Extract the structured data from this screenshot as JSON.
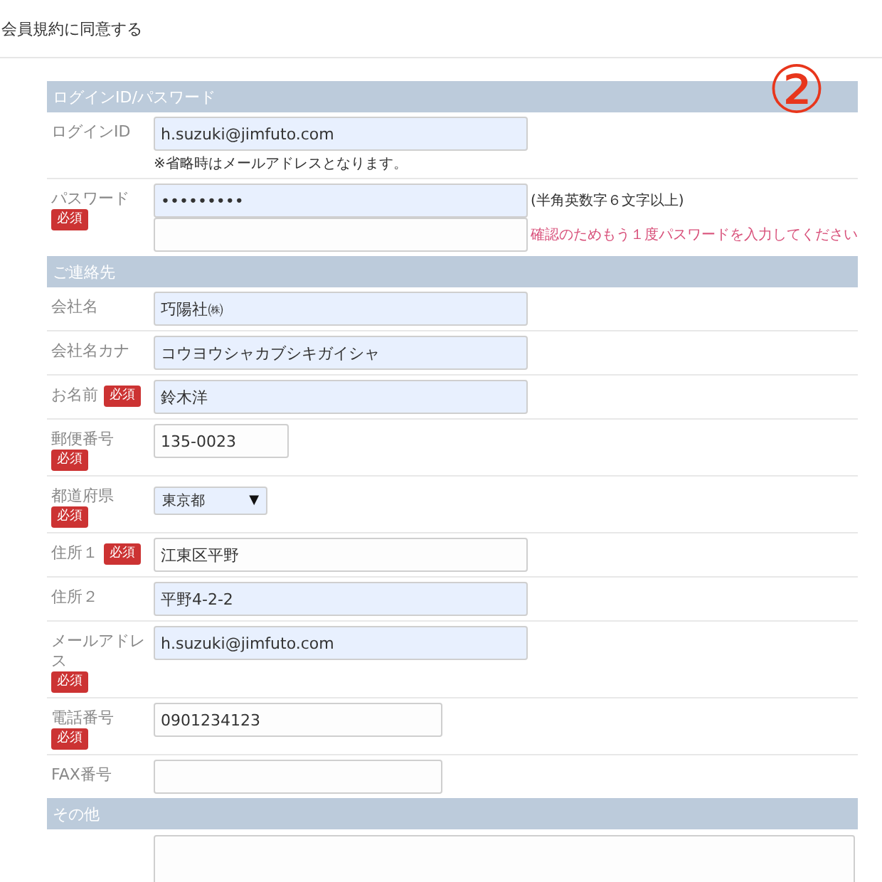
{
  "agreement": "会員規約に同意する",
  "annotation": "②",
  "sections": [
    {
      "title": "ログインID/パスワード",
      "rows": [
        {
          "label": "ログインID",
          "required": false,
          "inputs": [
            {
              "kind": "wide",
              "value": "h.suzuki@jimfuto.com",
              "autofilled": true
            }
          ],
          "note": "※省略時はメールアドレスとなります。"
        },
        {
          "label": "パスワード",
          "required": true,
          "badge": "必須",
          "inputs": [
            {
              "kind": "wide",
              "value": "•••••••••",
              "autofilled": true,
              "hint": "(半角英数字６文字以上)"
            },
            {
              "kind": "wide",
              "autofilled": false,
              "hint": "確認のためもう１度パスワードを入力してください",
              "hint_alert": true
            }
          ]
        }
      ]
    },
    {
      "title": "ご連絡先",
      "rows": [
        {
          "label": "会社名",
          "required": false,
          "inputs": [
            {
              "kind": "wide",
              "value": "巧陽社㈱",
              "autofilled": true
            }
          ]
        },
        {
          "label": "会社名カナ",
          "required": false,
          "inputs": [
            {
              "kind": "wide",
              "value": "コウヨウシャカブシキガイシャ",
              "autofilled": true
            }
          ]
        },
        {
          "label": "お名前",
          "required": true,
          "badge": "必須",
          "inputs": [
            {
              "kind": "wide",
              "value": "鈴木洋",
              "autofilled": true
            }
          ]
        },
        {
          "label": "郵便番号",
          "required": true,
          "badge": "必須",
          "inputs": [
            {
              "kind": "short",
              "value": "135-0023",
              "autofilled": false
            }
          ]
        },
        {
          "label": "都道府県",
          "required": true,
          "badge": "必須",
          "inputs": [
            {
              "kind": "select",
              "value": "東京都",
              "caret": "▼",
              "autofilled": true
            }
          ]
        },
        {
          "label": "住所１",
          "required": true,
          "badge": "必須",
          "inputs": [
            {
              "kind": "wide",
              "value": "江東区平野",
              "autofilled": false
            }
          ]
        },
        {
          "label": "住所２",
          "required": false,
          "inputs": [
            {
              "kind": "wide",
              "value": "平野4-2-2",
              "autofilled": true
            }
          ]
        },
        {
          "label": "メールアドレス",
          "required": true,
          "badge": "必須",
          "inputs": [
            {
              "kind": "wide",
              "value": "h.suzuki@jimfuto.com",
              "autofilled": true
            }
          ]
        },
        {
          "label": "電話番号",
          "required": true,
          "badge": "必須",
          "inputs": [
            {
              "kind": "medium",
              "value": "0901234123",
              "autofilled": false
            }
          ]
        },
        {
          "label": "FAX番号",
          "required": false,
          "inputs": [
            {
              "kind": "medium",
              "autofilled": false
            }
          ]
        }
      ]
    },
    {
      "title": "その他",
      "rows": [
        {
          "required": false,
          "inputs": [
            {
              "kind": "textarea",
              "autofilled": false
            }
          ]
        }
      ]
    }
  ]
}
